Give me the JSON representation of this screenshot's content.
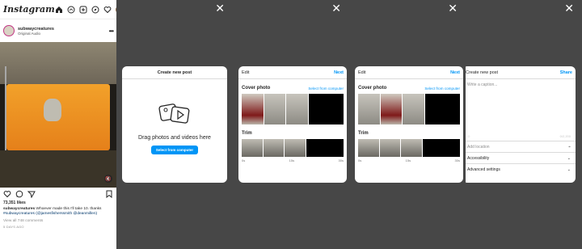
{
  "feed": {
    "logo": "Instagram",
    "user": "subwaycreatures",
    "audio": "Original Audio",
    "likes": "73,351 likes",
    "caption_user": "subwaycreatures",
    "caption_text": "Whoever made this I'll take 10. thanks",
    "caption_tags": "#subwaycreatures (@jamesfisherssmith @deanmillen)",
    "view_all": "View all 748 comments",
    "time_ago": "5 DAYS AGO"
  },
  "create_modal": {
    "title": "Create new post",
    "drop_text": "Drag photos and videos here",
    "select_button": "Select from computer"
  },
  "edit_modal": {
    "title": "Edit",
    "next": "Next",
    "cover_photo": "Cover photo",
    "select_from_computer": "Select from computer",
    "trim": "Trim",
    "tick_start": "0s",
    "tick_mid": "15s",
    "tick_end": "30s"
  },
  "share_modal": {
    "title": "Create new post",
    "share": "Share",
    "caption_placeholder": "Write a caption...",
    "counter": "0/2,200",
    "add_location": "Add location",
    "accessibility": "Accessibility",
    "advanced_settings": "Advanced settings"
  },
  "colors": {
    "accent": "#0095f6",
    "text": "#262626",
    "overlay": "#000000"
  }
}
